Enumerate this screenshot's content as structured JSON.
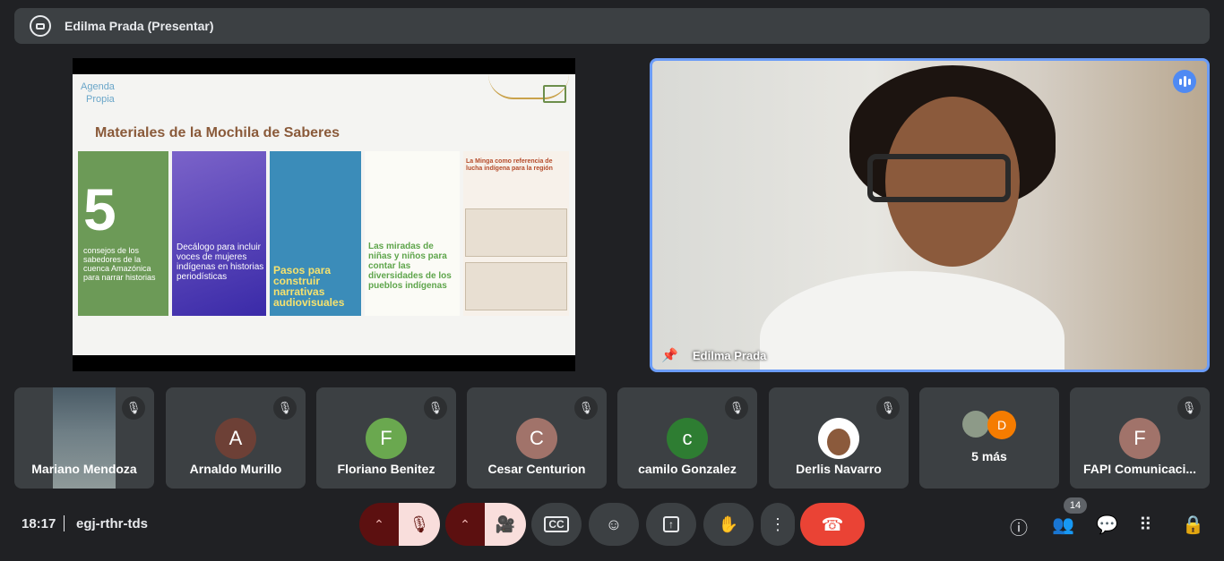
{
  "topbar": {
    "title": "Edilma Prada (Presentar)"
  },
  "slide": {
    "logo_line1": "Agenda",
    "logo_line2": "Propia",
    "title": "Materiales de la Mochila de Saberes",
    "cards": [
      {
        "big": "5",
        "text": "consejos de los sabedores de la cuenca Amazónica para narrar historias"
      },
      {
        "text": "Decálogo para incluir voces de mujeres indígenas en historias periodísticas"
      },
      {
        "text": "Pasos para construir narrativas audiovisuales"
      },
      {
        "text": "Las miradas de niñas y niños para contar las diversidades de los pueblos indígenas"
      },
      {
        "text": "La Minga como referencia de lucha indígena para la región"
      }
    ]
  },
  "speaker": {
    "name": "Edilma Prada"
  },
  "participants": [
    {
      "name": "Mariano Mendoza",
      "initial": "",
      "color": ""
    },
    {
      "name": "Arnaldo Murillo",
      "initial": "A",
      "color": "#6d4036"
    },
    {
      "name": "Floriano Benitez",
      "initial": "F",
      "color": "#6aa84f"
    },
    {
      "name": "Cesar Centurion",
      "initial": "C",
      "color": "#a1736a"
    },
    {
      "name": "camilo Gonzalez",
      "initial": "c",
      "color": "#2e7d32"
    },
    {
      "name": "Derlis Navarro",
      "initial": "",
      "color": "#ffffff"
    },
    {
      "name": "5 más",
      "initial": "D",
      "color": "#f57c00"
    },
    {
      "name": "FAPI Comunicaci...",
      "initial": "F",
      "color": "#a1736a"
    }
  ],
  "bottom": {
    "time": "18:17",
    "meeting_code": "egj-rthr-tds",
    "people_count": "14"
  },
  "icons": {
    "present": "presentation-icon",
    "mic": "mic-off-icon",
    "cam": "camera-off-icon",
    "cc": "captions-icon",
    "emoji": "emoji-icon",
    "share": "present-screen-icon",
    "hand": "raise-hand-icon",
    "more": "more-vert-icon",
    "end": "end-call-icon",
    "info": "info-icon",
    "people": "people-icon",
    "chat": "chat-icon",
    "activities": "activities-icon",
    "host": "host-controls-icon"
  }
}
